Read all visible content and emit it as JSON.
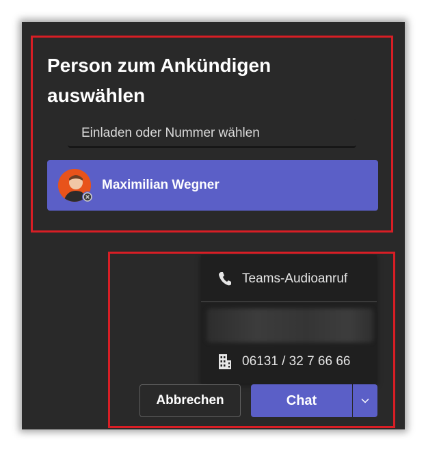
{
  "dialog": {
    "title": "Person zum Ankündigen auswählen",
    "search_placeholder": "Einladen oder Nummer wählen"
  },
  "selected_person": {
    "name": "Maximilian Wegner",
    "avatar": "person-photo",
    "presence": "offline-icon"
  },
  "call_menu": {
    "items": [
      {
        "label": "Teams-Audioanruf",
        "icon": "phone-icon"
      },
      {
        "label": "",
        "note": "blurred entry"
      },
      {
        "label": "06131 / 32 7 66 66",
        "icon": "building-icon"
      }
    ]
  },
  "actions": {
    "cancel_label": "Abbrechen",
    "chat_label": "Chat",
    "split_icon": "chevron-down-icon"
  },
  "colors": {
    "panel_bg": "#292929",
    "accent": "#5b5fc7",
    "highlight": "#d81e25"
  }
}
